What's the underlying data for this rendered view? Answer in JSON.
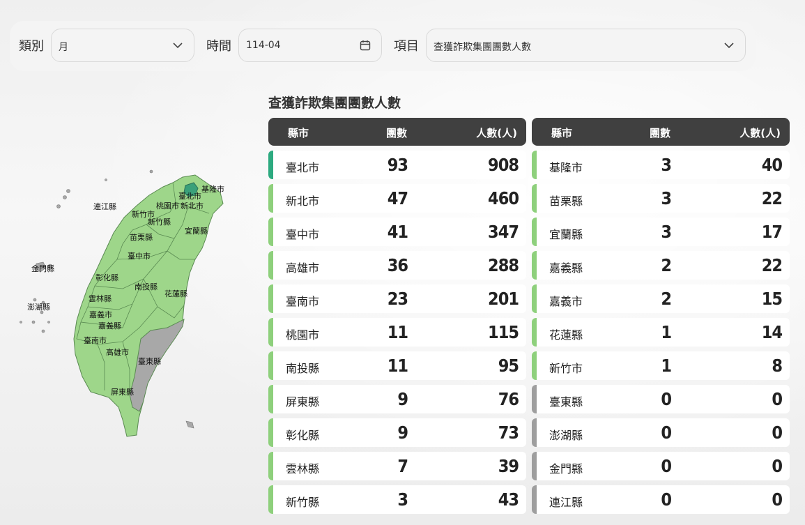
{
  "filters": {
    "category_label": "類別",
    "category_value": "月",
    "time_label": "時間",
    "time_value": "114-04",
    "item_label": "項目",
    "item_value": "查獲詐欺集團團數人數"
  },
  "table_title": "查獲詐欺集團團數人數",
  "headers": {
    "city": "縣市",
    "groups": "團數",
    "people": "人數(人)"
  },
  "colors": {
    "highlight": "#2daa80",
    "active": "#8ed07c",
    "zero": "#9e9e9e",
    "header_bg": "#404040",
    "map_fill": "#9ed68a",
    "map_zero": "#a8a8a8"
  },
  "left_rows": [
    {
      "city": "臺北市",
      "groups": "93",
      "people": "908"
    },
    {
      "city": "新北市",
      "groups": "47",
      "people": "460"
    },
    {
      "city": "臺中市",
      "groups": "41",
      "people": "347"
    },
    {
      "city": "高雄市",
      "groups": "36",
      "people": "288"
    },
    {
      "city": "臺南市",
      "groups": "23",
      "people": "201"
    },
    {
      "city": "桃園市",
      "groups": "11",
      "people": "115"
    },
    {
      "city": "南投縣",
      "groups": "11",
      "people": "95"
    },
    {
      "city": "屏東縣",
      "groups": "9",
      "people": "76"
    },
    {
      "city": "彰化縣",
      "groups": "9",
      "people": "73"
    },
    {
      "city": "雲林縣",
      "groups": "7",
      "people": "39"
    },
    {
      "city": "新竹縣",
      "groups": "3",
      "people": "43"
    }
  ],
  "right_rows": [
    {
      "city": "基隆市",
      "groups": "3",
      "people": "40"
    },
    {
      "city": "苗栗縣",
      "groups": "3",
      "people": "22"
    },
    {
      "city": "宜蘭縣",
      "groups": "3",
      "people": "17"
    },
    {
      "city": "嘉義縣",
      "groups": "2",
      "people": "22"
    },
    {
      "city": "嘉義市",
      "groups": "2",
      "people": "15"
    },
    {
      "city": "花蓮縣",
      "groups": "1",
      "people": "14"
    },
    {
      "city": "新竹市",
      "groups": "1",
      "people": "8"
    },
    {
      "city": "臺東縣",
      "groups": "0",
      "people": "0"
    },
    {
      "city": "澎湖縣",
      "groups": "0",
      "people": "0"
    },
    {
      "city": "金門縣",
      "groups": "0",
      "people": "0"
    },
    {
      "city": "連江縣",
      "groups": "0",
      "people": "0"
    }
  ],
  "map_labels": {
    "keelung": "基隆市",
    "taipei": "臺北市",
    "taoyuan": "桃園市",
    "new_taipei": "新北市",
    "hsinchu_city": "新竹市",
    "hsinchu_county": "新竹縣",
    "yilan": "宜蘭縣",
    "miaoli": "苗栗縣",
    "taichung": "臺中市",
    "changhua": "彰化縣",
    "nantou": "南投縣",
    "hualien": "花蓮縣",
    "yunlin": "雲林縣",
    "chiayi_city": "嘉義市",
    "chiayi_county": "嘉義縣",
    "tainan": "臺南市",
    "kaohsiung": "高雄市",
    "taitung": "臺東縣",
    "pingtung": "屏東縣",
    "lienchiang": "連江縣",
    "kinmen": "金門縣",
    "penghu": "澎湖縣"
  }
}
